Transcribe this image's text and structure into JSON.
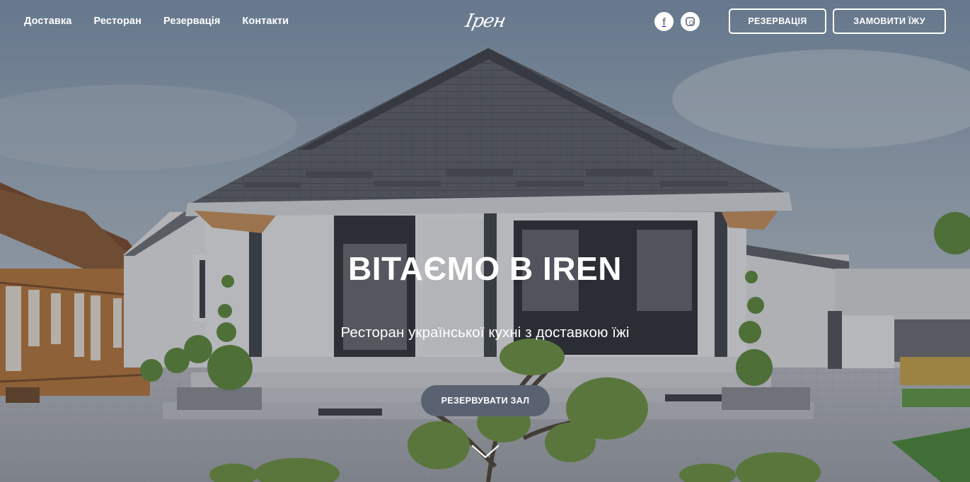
{
  "header": {
    "nav": [
      {
        "label": "Доставка"
      },
      {
        "label": "Ресторан"
      },
      {
        "label": "Резервація"
      },
      {
        "label": "Контакти"
      }
    ],
    "logo_text": "Ірен",
    "social": {
      "facebook_glyph": "f",
      "facebook_icon": "facebook-icon",
      "instagram_icon": "instagram-icon"
    },
    "reserve_label": "РЕЗЕРВАЦІЯ",
    "order_label": "ЗАМОВИТИ ЇЖУ"
  },
  "hero": {
    "title": "ВІТАЄМО В IREN",
    "subtitle": "Ресторан української кухні з доставкою їжі",
    "cta_label": "РЕЗЕРВУВАТИ ЗАЛ",
    "scroll_icon": "chevron-down-icon"
  },
  "colors": {
    "cta_background": "#5a6170",
    "overlay": "rgba(40,44,52,0.28)",
    "text": "#ffffff"
  }
}
